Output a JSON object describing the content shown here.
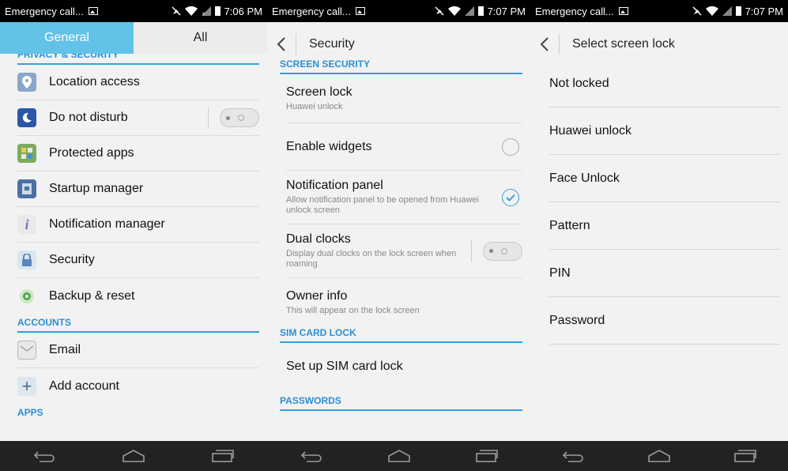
{
  "panels": [
    {
      "status": {
        "left_text": "Emergency call...",
        "time": "7:06 PM"
      },
      "tabs": [
        "General",
        "All"
      ],
      "section_privacy": "PRIVACY & SECURITY",
      "items_a": [
        {
          "label": "Location access",
          "icon": "location-pin-icon"
        },
        {
          "label": "Do not disturb",
          "icon": "moon-icon"
        },
        {
          "label": "Protected apps",
          "icon": "shield-check-icon"
        },
        {
          "label": "Startup manager",
          "icon": "startup-manager-icon"
        },
        {
          "label": "Notification manager",
          "icon": "info-icon"
        },
        {
          "label": "Security",
          "icon": "padlock-icon"
        },
        {
          "label": "Backup & reset",
          "icon": "backup-reset-icon"
        }
      ],
      "section_accounts": "ACCOUNTS",
      "items_b": [
        {
          "label": "Email",
          "icon": "envelope-icon"
        },
        {
          "label": "Add account",
          "icon": "plus-icon"
        }
      ],
      "section_apps": "APPS"
    },
    {
      "status": {
        "left_text": "Emergency call...",
        "time": "7:07 PM"
      },
      "title": "Security",
      "section_screen": "SCREEN SECURITY",
      "screen_lock": {
        "title": "Screen lock",
        "sub": "Huawei unlock"
      },
      "enable_widgets": {
        "title": "Enable widgets"
      },
      "notification_panel": {
        "title": "Notification panel",
        "sub": "Allow notification panel to be opened from Huawei unlock screen"
      },
      "dual_clocks": {
        "title": "Dual clocks",
        "sub": "Display dual clocks on the lock screen when roaming"
      },
      "owner_info": {
        "title": "Owner info",
        "sub": "This will appear on the lock screen"
      },
      "section_sim": "SIM CARD LOCK",
      "sim_lock": {
        "title": "Set up SIM card lock"
      },
      "section_passwords": "PASSWORDS"
    },
    {
      "status": {
        "left_text": "Emergency call...",
        "time": "7:07 PM"
      },
      "title": "Select screen lock",
      "options": [
        "Not locked",
        "Huawei unlock",
        "Face Unlock",
        "Pattern",
        "PIN",
        "Password"
      ]
    }
  ],
  "colors": {
    "accent": "#33a1df",
    "tab_active": "#62c2e8",
    "section_text": "#2b8fd6"
  }
}
